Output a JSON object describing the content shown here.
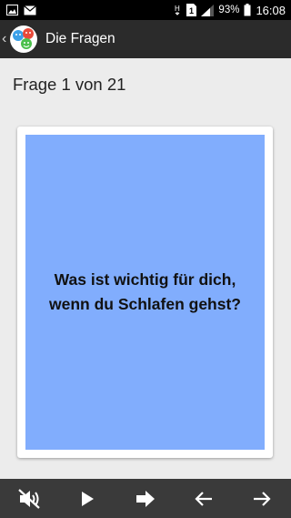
{
  "status_bar": {
    "battery": "93%",
    "time": "16:08",
    "icons": [
      "picture-icon",
      "mail-icon",
      "h-network-icon",
      "sim-1-icon",
      "signal-icon",
      "battery-icon"
    ]
  },
  "app_bar": {
    "title": "Die Fragen",
    "icons": [
      "back-chevron-icon",
      "app-logo-icon"
    ]
  },
  "question": {
    "counter": "Frage 1 von 21",
    "text": "Was ist wichtig für dich, wenn du Schlafen gehst?"
  },
  "card": {
    "background": "#81adfd"
  },
  "bottom_bar": {
    "buttons": [
      "mute-icon",
      "play-icon",
      "next-arrow-icon",
      "previous-icon",
      "forward-icon"
    ]
  },
  "colors": {
    "status_bar": "#000000",
    "app_bar": "#2b2b2b",
    "content_bg": "#ececec",
    "bottom_bar": "#3a3a3a",
    "card": "#81adfd"
  }
}
